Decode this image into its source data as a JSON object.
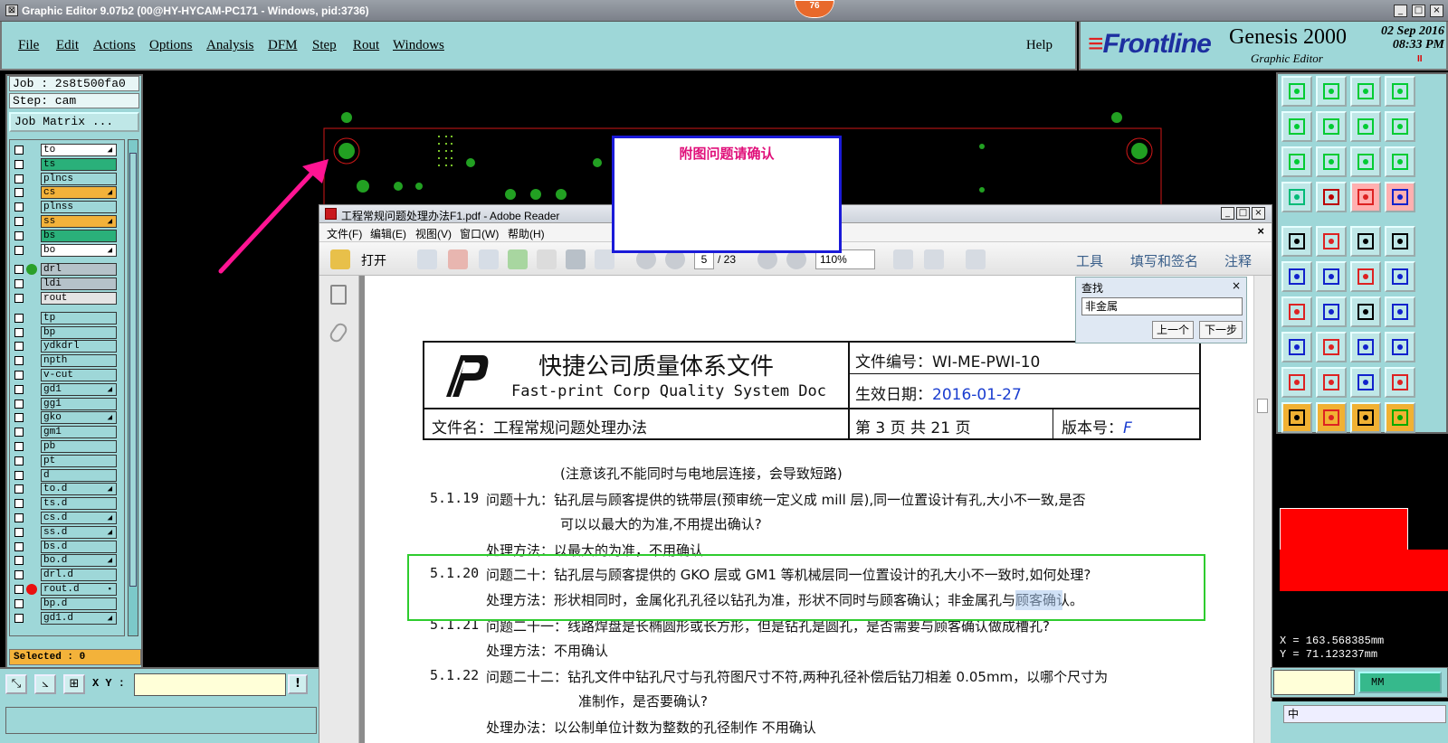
{
  "window": {
    "title": "Graphic Editor 9.07b2 (00@HY-HYCAM-PC171 - Windows, pid:3736)",
    "badge": "76",
    "controls": [
      "_",
      "□",
      "×"
    ]
  },
  "menu": {
    "items": [
      "File",
      "Edit",
      "Actions",
      "Options",
      "Analysis",
      "DFM",
      "Step",
      "Rout",
      "Windows"
    ],
    "help": "Help"
  },
  "brand": {
    "logo": "Frontline",
    "product": "Genesis 2000",
    "subtitle": "Graphic Editor",
    "date": "02  Sep  2016",
    "time": "08:33  PM",
    "pause": "II"
  },
  "left": {
    "job": "Job : 2s8t500fa0",
    "step": "Step: cam",
    "job_matrix": "Job Matrix ...",
    "selected": "Selected : 0",
    "layers": [
      {
        "name": "to",
        "color": "#ffffff",
        "arrow": "◢"
      },
      {
        "name": "ts",
        "color": "#2ab07a",
        "arrow": ""
      },
      {
        "name": "plncs",
        "color": "#9ed7d8",
        "arrow": ""
      },
      {
        "name": "cs",
        "color": "#f3b23a",
        "arrow": "◢"
      },
      {
        "name": "plnss",
        "color": "#9ed7d8",
        "arrow": ""
      },
      {
        "name": "ss",
        "color": "#f3b23a",
        "arrow": "◢"
      },
      {
        "name": "bs",
        "color": "#2ab07a",
        "arrow": ""
      },
      {
        "name": "bo",
        "color": "#ffffff",
        "arrow": "◢"
      },
      {
        "name": "drl",
        "color": "#b5c2c9",
        "arrow": "",
        "dot": "#2aa02a"
      },
      {
        "name": "ldi",
        "color": "#b5c2c9",
        "arrow": ""
      },
      {
        "name": "rout",
        "color": "#e4e4e4",
        "arrow": ""
      },
      {
        "name": "tp",
        "color": "#9ed7d8",
        "arrow": ""
      },
      {
        "name": "bp",
        "color": "#9ed7d8",
        "arrow": ""
      },
      {
        "name": "ydkdrl",
        "color": "#9ed7d8",
        "arrow": ""
      },
      {
        "name": "npth",
        "color": "#9ed7d8",
        "arrow": ""
      },
      {
        "name": "v-cut",
        "color": "#9ed7d8",
        "arrow": ""
      },
      {
        "name": "gd1",
        "color": "#9ed7d8",
        "arrow": "◢"
      },
      {
        "name": "gg1",
        "color": "#9ed7d8",
        "arrow": ""
      },
      {
        "name": "gko",
        "color": "#9ed7d8",
        "arrow": "◢"
      },
      {
        "name": "gm1",
        "color": "#9ed7d8",
        "arrow": ""
      },
      {
        "name": "pb",
        "color": "#9ed7d8",
        "arrow": ""
      },
      {
        "name": "pt",
        "color": "#9ed7d8",
        "arrow": ""
      },
      {
        "name": "d",
        "color": "#9ed7d8",
        "arrow": ""
      },
      {
        "name": "to.d",
        "color": "#9ed7d8",
        "arrow": "◢"
      },
      {
        "name": "ts.d",
        "color": "#9ed7d8",
        "arrow": ""
      },
      {
        "name": "cs.d",
        "color": "#9ed7d8",
        "arrow": "◢"
      },
      {
        "name": "ss.d",
        "color": "#9ed7d8",
        "arrow": "◢"
      },
      {
        "name": "bs.d",
        "color": "#9ed7d8",
        "arrow": ""
      },
      {
        "name": "bo.d",
        "color": "#9ed7d8",
        "arrow": "◢"
      },
      {
        "name": "drl.d",
        "color": "#9ed7d8",
        "arrow": ""
      },
      {
        "name": "rout.d",
        "color": "#9ed7d8",
        "arrow": "▪",
        "dot": "#e81010"
      },
      {
        "name": "bp.d",
        "color": "#9ed7d8",
        "arrow": ""
      },
      {
        "name": "gd1.d",
        "color": "#9ed7d8",
        "arrow": "◢"
      }
    ]
  },
  "bottom": {
    "xy_label": "X Y :",
    "bang": "!"
  },
  "note": {
    "text": "附图问题请确认"
  },
  "adobe": {
    "title": "工程常规问题处理办法F1.pdf - Adobe Reader",
    "menu": [
      "文件(F)",
      "编辑(E)",
      "视图(V)",
      "窗口(W)",
      "帮助(H)"
    ],
    "open": "打开",
    "page_current": "5",
    "page_total": "/ 23",
    "zoom": "110%",
    "tabs": [
      "工具",
      "填写和签名",
      "注释"
    ],
    "find": {
      "title": "查找",
      "value": "非金属",
      "prev": "上一个",
      "next": "下一步"
    },
    "doc": {
      "company_cn": "快捷公司质量体系文件",
      "company_en": "Fast-print Corp Quality System Doc",
      "doc_no": "文件编号：WI-ME-PWI-10",
      "eff_label": "生效日期：",
      "eff_date": "2016-01-27",
      "file_name": "文件名：工程常规问题处理办法",
      "page_info": "第 3 页 共 21 页",
      "ver_label": "版本号：",
      "ver": "F",
      "lines": [
        {
          "num": "",
          "text": "(注意该孔不能同时与电地层连接，会导致短路)"
        },
        {
          "num": "5.1.19",
          "text": "问题十九：钻孔层与顾客提供的铣带层(预审统一定义成 mill 层),同一位置设计有孔,大小不一致,是否"
        },
        {
          "num": "",
          "text": "可以以最大的为准,不用提出确认?"
        },
        {
          "num": "",
          "text": "处理方法：以最大的为准，不用确认"
        },
        {
          "num": "5.1.20",
          "text": "问题二十：钻孔层与顾客提供的 GKO 层或 GM1 等机械层同一位置设计的孔大小不一致时,如何处理?"
        },
        {
          "num": "",
          "text": "处理方法：形状相同时，金属化孔孔径以钻孔为准，形状不同时与顾客确认；非金属孔与顾客确认。"
        },
        {
          "num": "5.1.21",
          "text": "问题二十一：线路焊盘是长椭圆形或长方形，但是钻孔是圆孔，是否需要与顾客确认做成槽孔?"
        },
        {
          "num": "",
          "text": "处理方法：不用确认"
        },
        {
          "num": "5.1.22",
          "text": "问题二十二：钻孔文件中钻孔尺寸与孔符图尺寸不符,两种孔径补偿后钻刀相差 0.05mm，以哪个尺寸为"
        },
        {
          "num": "",
          "text": "准制作，是否要确认?"
        },
        {
          "num": "",
          "text": "处理办法：以公制单位计数为整数的孔径制作 不用确认"
        }
      ]
    }
  },
  "right": {
    "x": "X  =  163.568385mm",
    "y": "Y  =  71.123237mm",
    "unit": "MM",
    "lang": "中"
  }
}
